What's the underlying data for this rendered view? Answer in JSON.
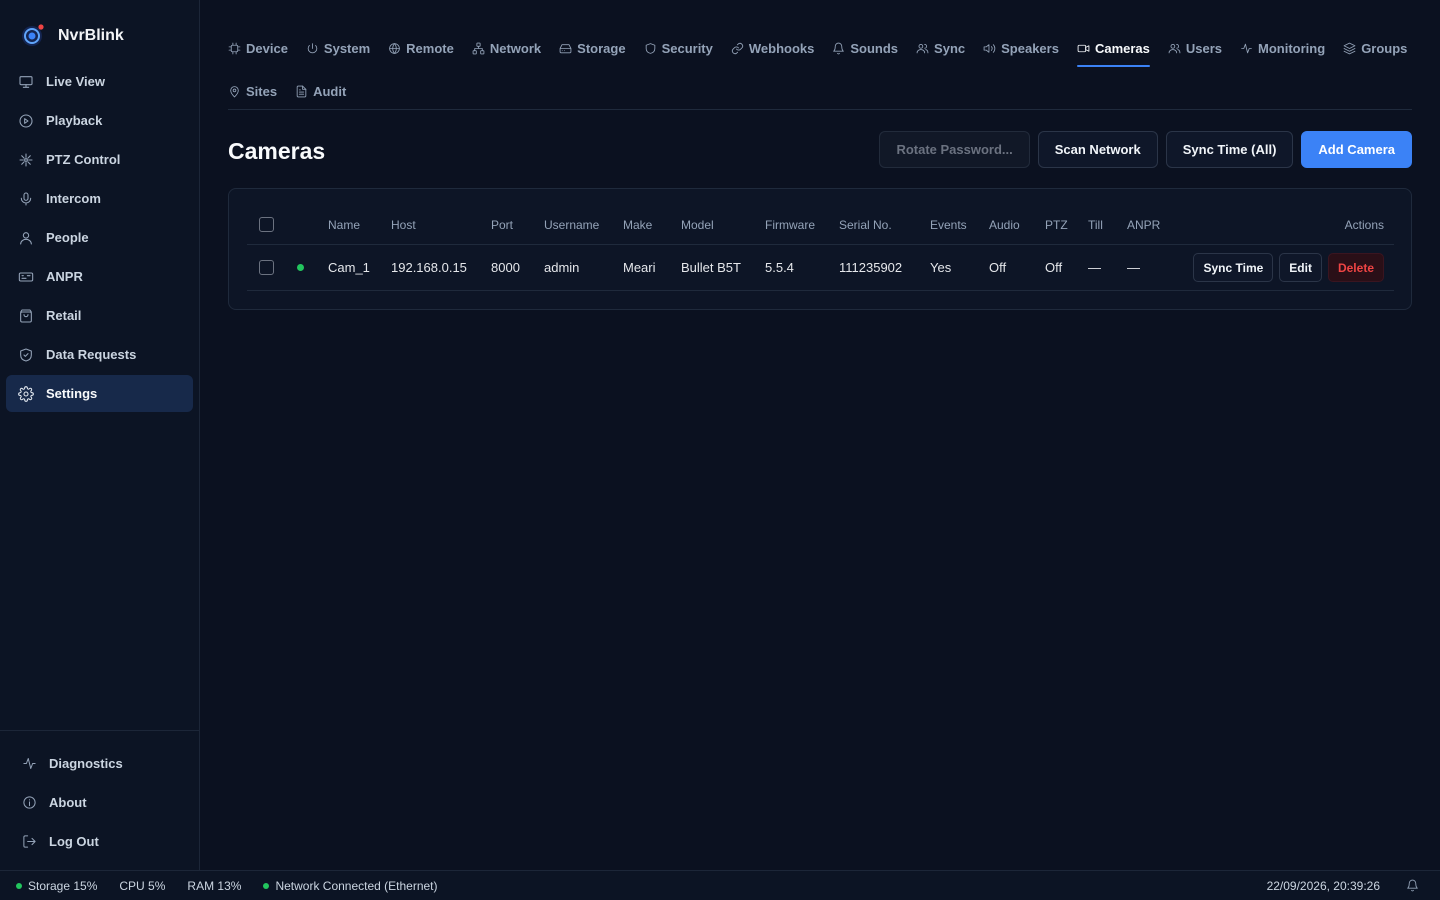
{
  "app": {
    "name": "NvrBlink",
    "accent": "#3b82f6",
    "logo_dot_color": "#ef4444"
  },
  "sidebar": {
    "items": [
      {
        "label": "Live View",
        "icon": "monitor-icon"
      },
      {
        "label": "Playback",
        "icon": "play-circle-icon"
      },
      {
        "label": "PTZ Control",
        "icon": "ptz-icon"
      },
      {
        "label": "Intercom",
        "icon": "microphone-icon"
      },
      {
        "label": "People",
        "icon": "person-icon"
      },
      {
        "label": "ANPR",
        "icon": "license-plate-icon"
      },
      {
        "label": "Retail",
        "icon": "shopping-bag-icon"
      },
      {
        "label": "Data Requests",
        "icon": "shield-check-icon"
      },
      {
        "label": "Settings",
        "icon": "gear-icon",
        "active": true
      }
    ],
    "bottom": [
      {
        "label": "Diagnostics",
        "icon": "activity-icon"
      },
      {
        "label": "About",
        "icon": "info-icon"
      },
      {
        "label": "Log Out",
        "icon": "logout-icon"
      }
    ]
  },
  "tabs": [
    {
      "label": "Device",
      "icon": "chip-icon"
    },
    {
      "label": "System",
      "icon": "power-icon"
    },
    {
      "label": "Remote",
      "icon": "globe-icon"
    },
    {
      "label": "Network",
      "icon": "network-icon"
    },
    {
      "label": "Storage",
      "icon": "hard-drive-icon"
    },
    {
      "label": "Security",
      "icon": "shield-icon"
    },
    {
      "label": "Webhooks",
      "icon": "link-icon"
    },
    {
      "label": "Sounds",
      "icon": "bell-icon"
    },
    {
      "label": "Sync",
      "icon": "users-icon"
    },
    {
      "label": "Speakers",
      "icon": "speaker-icon"
    },
    {
      "label": "Cameras",
      "icon": "video-icon",
      "active": true
    },
    {
      "label": "Users",
      "icon": "users-icon"
    },
    {
      "label": "Monitoring",
      "icon": "activity-icon"
    },
    {
      "label": "Groups",
      "icon": "layers-icon"
    },
    {
      "label": "Sites",
      "icon": "map-pin-icon"
    },
    {
      "label": "Audit",
      "icon": "file-text-icon"
    }
  ],
  "page": {
    "title": "Cameras",
    "actions": {
      "rotate_password": "Rotate Password...",
      "scan_network": "Scan Network",
      "sync_time_all": "Sync Time (All)",
      "add_camera": "Add Camera"
    }
  },
  "table": {
    "columns": [
      "Name",
      "Host",
      "Port",
      "Username",
      "Make",
      "Model",
      "Firmware",
      "Serial No.",
      "Events",
      "Audio",
      "PTZ",
      "Till",
      "ANPR",
      "Actions"
    ],
    "rows": [
      {
        "status": "online",
        "name": "Cam_1",
        "host": "192.168.0.15",
        "port": "8000",
        "username": "admin",
        "make": "Meari",
        "model": "Bullet B5T",
        "firmware": "5.5.4",
        "serial": "111235902",
        "events": "Yes",
        "audio": "Off",
        "ptz": "Off",
        "till": "—",
        "anpr": "—",
        "actions": {
          "sync_time": "Sync Time",
          "edit": "Edit",
          "delete": "Delete"
        }
      }
    ]
  },
  "statusbar": {
    "storage": "Storage 15%",
    "cpu": "CPU 5%",
    "ram": "RAM 13%",
    "network": "Network Connected (Ethernet)",
    "datetime": "22/09/2026, 20:39:26"
  }
}
